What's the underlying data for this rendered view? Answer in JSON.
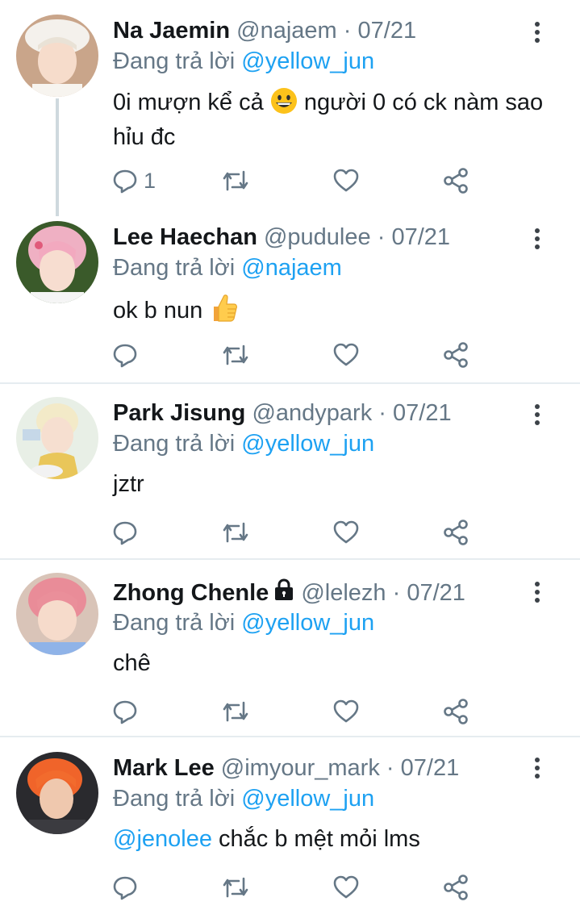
{
  "tweets": [
    {
      "name": "Na Jaemin",
      "handle": "@najaem",
      "date": "07/21",
      "reply_prefix": "Đang trả lời",
      "reply_to": "@yellow_jun",
      "text_before_emoji": "0i mượn kể cả",
      "emoji": "grinning-face",
      "text_after_emoji": "người 0 có ck nàm sao hỉu đc",
      "reply_count": "1"
    },
    {
      "name": "Lee Haechan",
      "handle": "@pudulee",
      "date": "07/21",
      "reply_prefix": "Đang trả lời",
      "reply_to": "@najaem",
      "text": "ok b nun",
      "emoji": "thumbs-up"
    },
    {
      "name": "Park Jisung",
      "handle": "@andypark",
      "date": "07/21",
      "reply_prefix": "Đang trả lời",
      "reply_to": "@yellow_jun",
      "text": "jztr"
    },
    {
      "name": "Zhong Chenle",
      "handle": "@lelezh",
      "date": "07/21",
      "protected_icon": "lock-icon",
      "reply_prefix": "Đang trả lời",
      "reply_to": "@yellow_jun",
      "text": "chê"
    },
    {
      "name": "Mark Lee",
      "handle": "@imyour_mark",
      "date": "07/21",
      "reply_prefix": "Đang trả lời",
      "reply_to": "@yellow_jun",
      "mention": "@jenolee",
      "text": "chắc b mệt mỏi lms"
    }
  ],
  "separator": "·",
  "icons": [
    "reply-icon",
    "retweet-icon",
    "like-icon",
    "share-icon",
    "more-options-icon"
  ],
  "colors": {
    "link": "#1da1f2",
    "secondary": "#657786",
    "divider": "#e6ecf0",
    "text": "#14171a"
  }
}
